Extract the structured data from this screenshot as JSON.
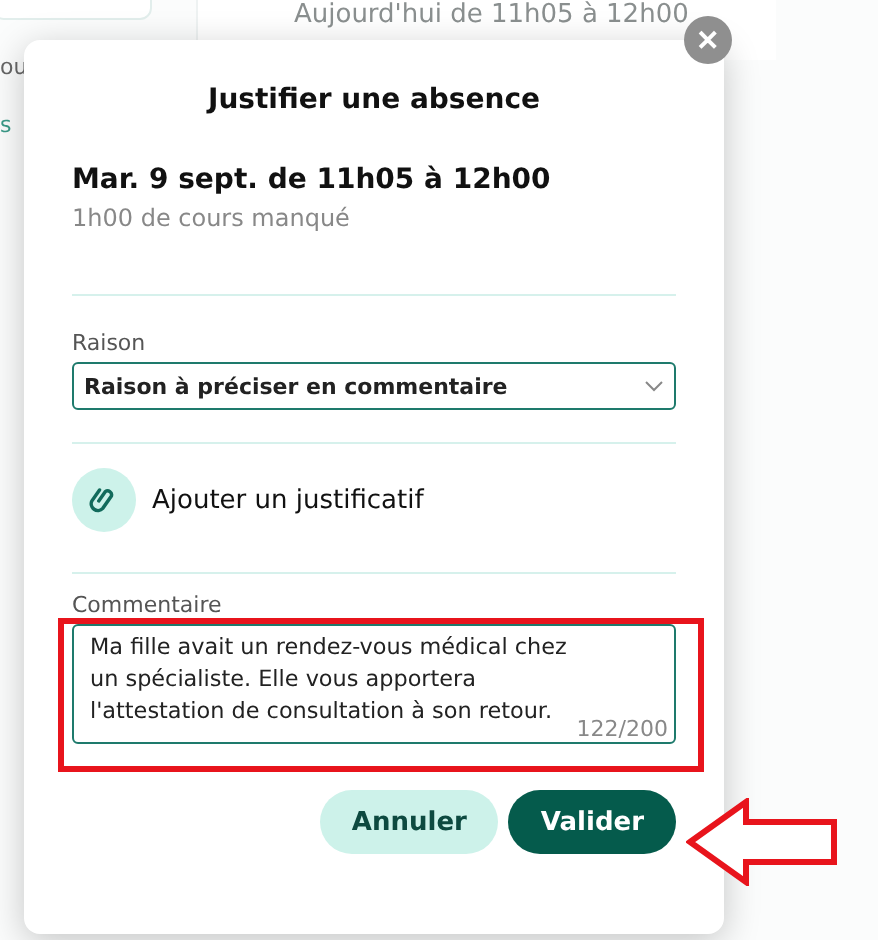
{
  "background": {
    "schedule_time": "Aujourd'hui de 11h05 à 12h00",
    "fragment_1": "ou",
    "fragment_2": "s"
  },
  "dialog": {
    "title": "Justifier une absence",
    "close": "✕",
    "date": "Mar. 9 sept. de 11h05 à 12h00",
    "missed": "1h00 de cours manqué",
    "reason": {
      "label": "Raison",
      "value": "Raison à préciser en commentaire"
    },
    "attachment": "Ajouter un justificatif",
    "comment": {
      "label": "Commentaire",
      "value": "Ma fille avait un rendez-vous médical chez un spécialiste. Elle vous apportera l'attestation de consultation à son retour.",
      "counter": "122/200"
    },
    "buttons": [
      {
        "kind": "secondary",
        "label": "Annuler"
      },
      {
        "kind": "primary",
        "label": "Valider"
      }
    ]
  }
}
